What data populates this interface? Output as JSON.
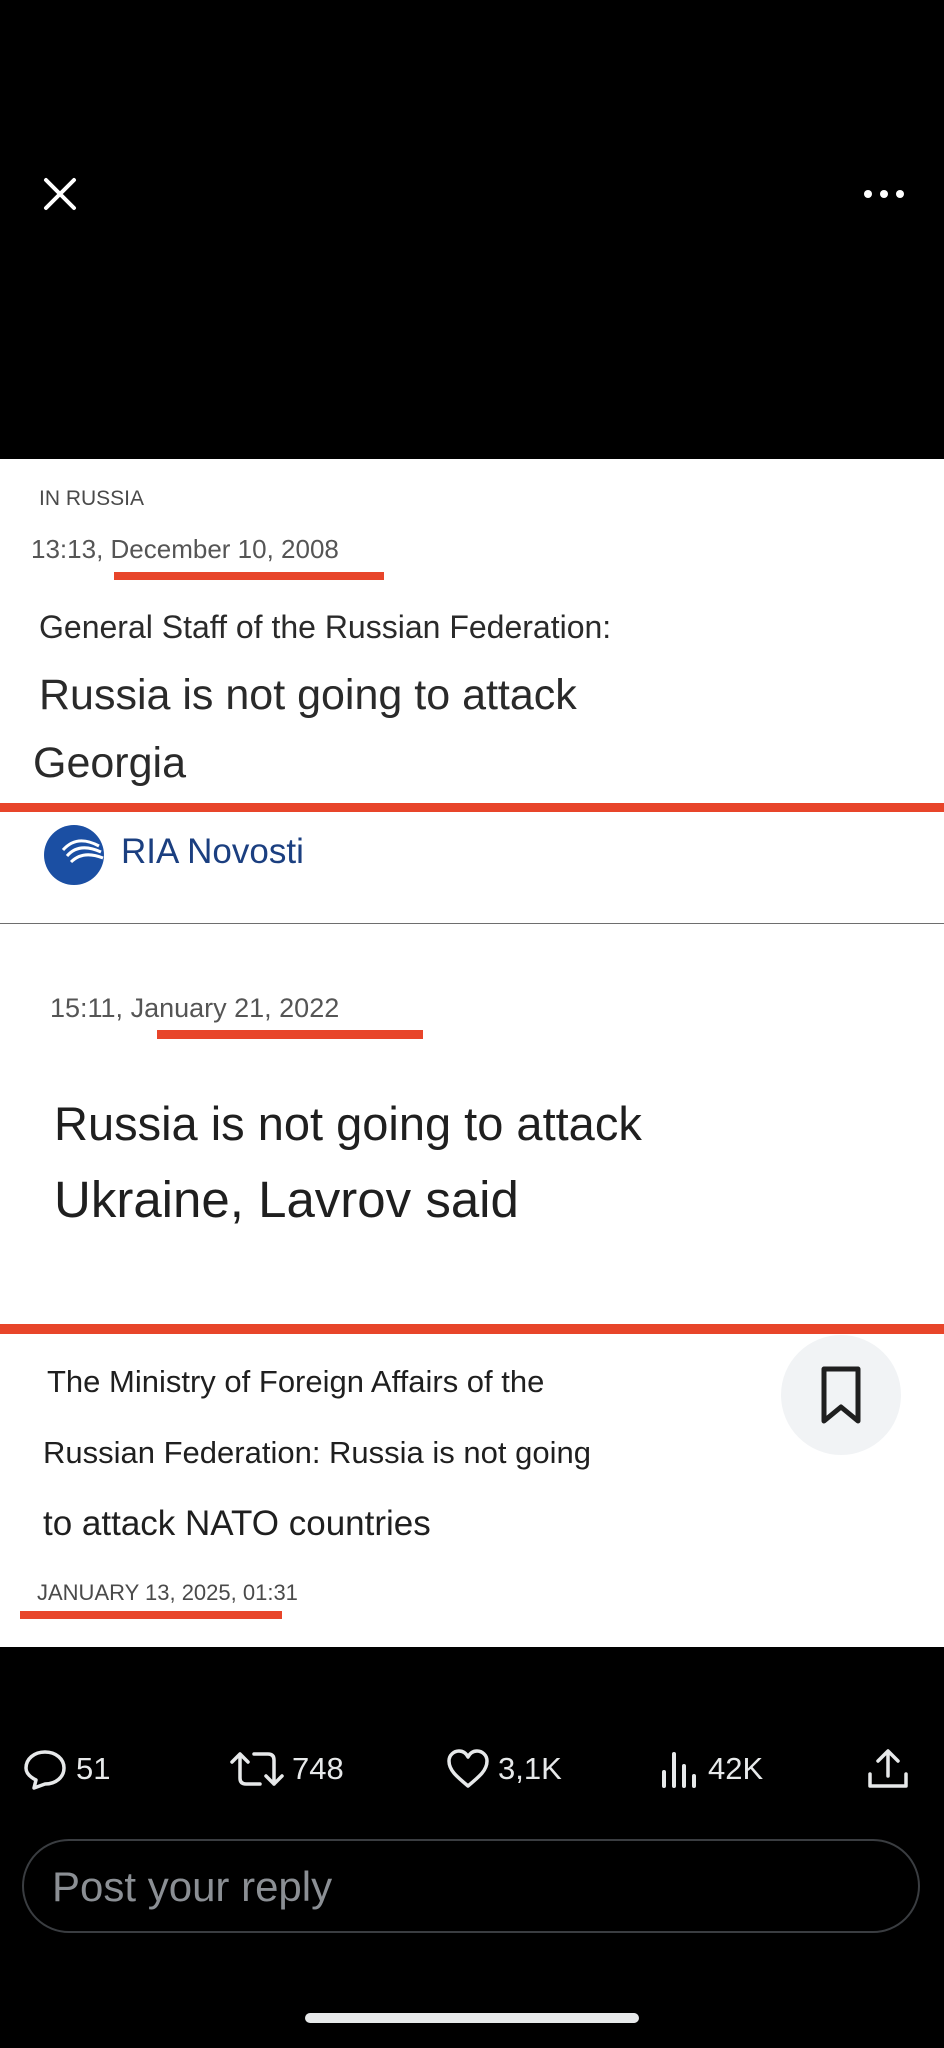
{
  "topbar": {
    "close_icon": "close-icon",
    "more_icon": "more-options-icon"
  },
  "media": {
    "article1": {
      "section": "IN RUSSIA",
      "timestamp": "13:13, December 10, 2008",
      "kicker": "General Staff of the Russian Federation:",
      "headline_line1": "Russia is not going to attack",
      "headline_line2": "Georgia",
      "source": "RIA Novosti",
      "source_logo": "ria-novosti-logo"
    },
    "article2": {
      "timestamp": "15:11, January 21, 2022",
      "headline_line1": "Russia is not going to attack",
      "headline_line2": "Ukraine, Lavrov said"
    },
    "article3": {
      "line1": "The Ministry of Foreign Affairs of the",
      "line2": "Russian Federation: Russia is not going",
      "line3": "to attack NATO countries",
      "date": "JANUARY 13, 2025, 01:31",
      "bookmark_icon": "bookmark-icon"
    },
    "colors": {
      "highlight": "#e8452a",
      "ria_blue": "#1b4fa3"
    }
  },
  "actions": {
    "replies": "51",
    "reposts": "748",
    "likes": "3,1K",
    "views": "42K"
  },
  "reply": {
    "placeholder": "Post your reply"
  }
}
